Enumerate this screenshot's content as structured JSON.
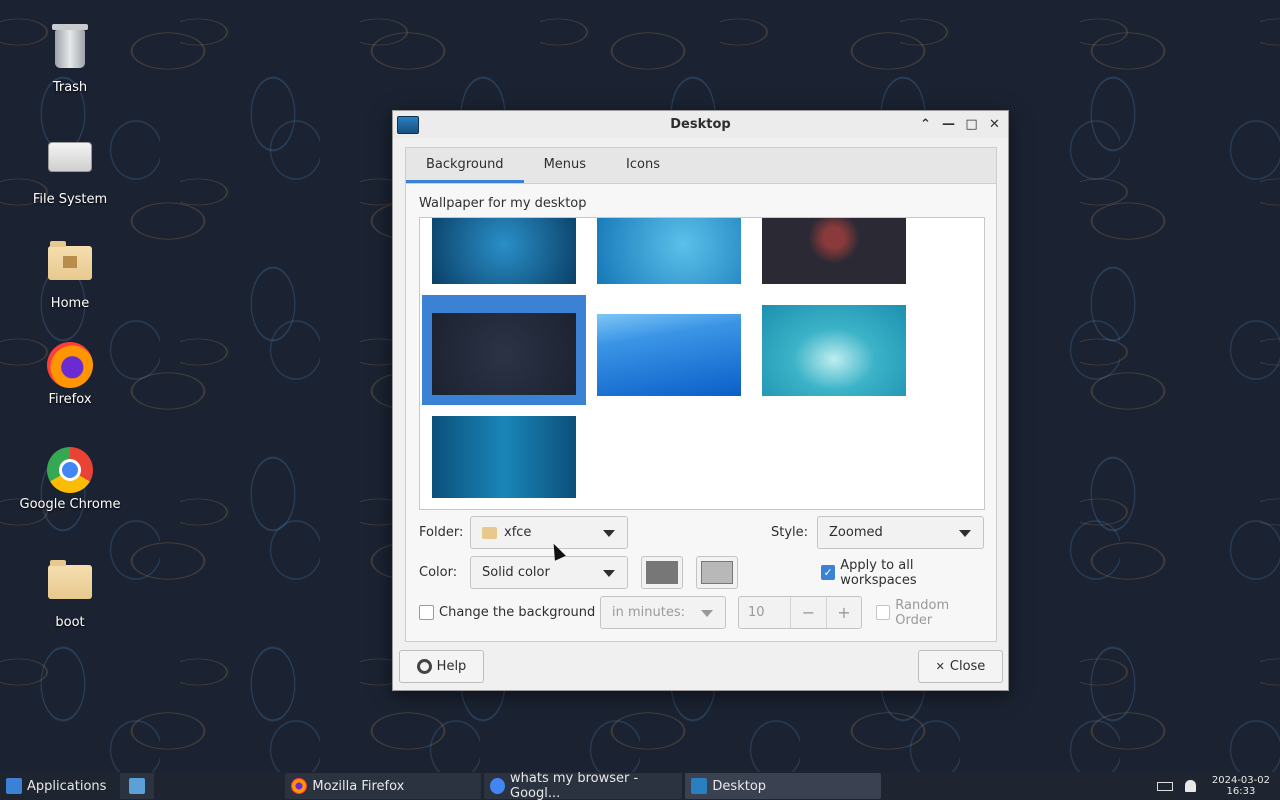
{
  "desktop": {
    "icons": [
      {
        "label": "Trash",
        "icon": "trash-icon"
      },
      {
        "label": "File System",
        "icon": "drive-icon"
      },
      {
        "label": "Home",
        "icon": "home-folder-icon"
      },
      {
        "label": "Firefox",
        "icon": "firefox-icon"
      },
      {
        "label": "Google Chrome",
        "icon": "chrome-icon"
      },
      {
        "label": "boot",
        "icon": "folder-icon"
      }
    ]
  },
  "window": {
    "title": "Desktop",
    "tabs": [
      {
        "label": "Background",
        "active": true
      },
      {
        "label": "Menus",
        "active": false
      },
      {
        "label": "Icons",
        "active": false
      }
    ],
    "wallpaper_label": "Wallpaper for my desktop",
    "wallpapers": [
      {
        "name": "wallpaper-1",
        "colors": [
          "#1b6fa0",
          "#0a3f66"
        ]
      },
      {
        "name": "wallpaper-2",
        "colors": [
          "#3aa6d8",
          "#1578b8"
        ]
      },
      {
        "name": "wallpaper-3",
        "colors": [
          "#2b2a34",
          "#3a2f38"
        ]
      },
      {
        "name": "wallpaper-4",
        "colors": [
          "#242a3a",
          "#1c2230"
        ],
        "selected": true
      },
      {
        "name": "wallpaper-5",
        "colors": [
          "#4aa9f0",
          "#0a5fc8"
        ]
      },
      {
        "name": "wallpaper-6",
        "colors": [
          "#5fd0d2",
          "#1c8fb0"
        ]
      },
      {
        "name": "wallpaper-7",
        "colors": [
          "#1a86b8",
          "#0b4f7a"
        ]
      }
    ],
    "folder_label": "Folder:",
    "folder_value": "xfce",
    "style_label": "Style:",
    "style_value": "Zoomed",
    "color_label": "Color:",
    "color_value": "Solid color",
    "color_swatch_1": "#777777",
    "color_swatch_2": "#b8b8b8",
    "apply_all_label": "Apply to all workspaces",
    "apply_all_checked": true,
    "change_bg_label": "Change the background",
    "change_bg_checked": false,
    "interval_value": "in minutes:",
    "interval_number": "10",
    "random_order_label": "Random Order",
    "help_label": "Help",
    "close_label": "Close"
  },
  "taskbar": {
    "applications_label": "Applications",
    "tasks": [
      {
        "label": "Mozilla Firefox"
      },
      {
        "label": "whats my browser - Googl..."
      },
      {
        "label": "Desktop"
      }
    ],
    "date": "2024-03-02",
    "time": "16:33"
  },
  "colors": {
    "accent": "#3c82d4",
    "desktop_bg": "#1b2332",
    "taskbar_bg": "#1f2530"
  }
}
